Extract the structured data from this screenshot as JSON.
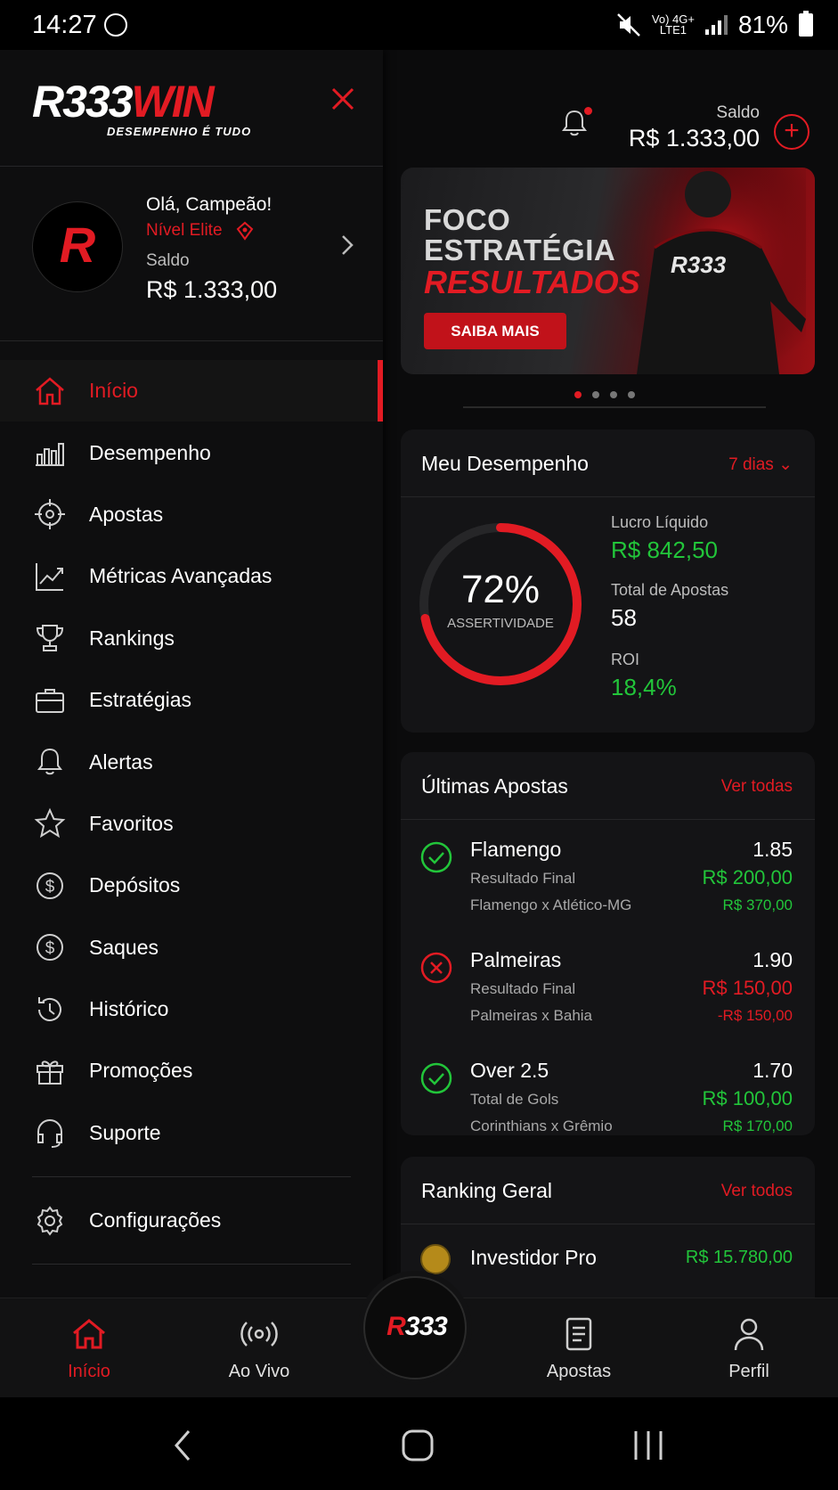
{
  "status_bar": {
    "time": "14:27",
    "network_top": "Vo) 4G+",
    "network_bottom": "LTE1",
    "battery": "81%"
  },
  "header": {
    "saldo_label": "Saldo",
    "saldo_value": "R$ 1.333,00",
    "add_icon": "plus-circle-icon",
    "bell_icon": "bell-icon"
  },
  "banner": {
    "line1": "FOCO",
    "line2": "ESTRATÉGIA",
    "line3": "RESULTADOS",
    "cta": "SAIBA MAIS",
    "jersey_text": "R333",
    "dots_count": 4,
    "active_dot": 0
  },
  "performance": {
    "title": "Meu Desempenho",
    "period": "7 dias",
    "percent_text": "72%",
    "percent": 72,
    "percent_label": "ASSERTIVIDADE",
    "stats": [
      {
        "label": "Lucro Líquido",
        "value": "R$ 842,50",
        "color": "#22c53a"
      },
      {
        "label": "Total de Apostas",
        "value": "58",
        "color": "#ffffff"
      },
      {
        "label": "ROI",
        "value": "18,4%",
        "color": "#22c53a"
      }
    ]
  },
  "bets": {
    "title": "Últimas Apostas",
    "link": "Ver todas",
    "items": [
      {
        "name": "Flamengo",
        "market": "Resultado Final",
        "match": "Flamengo x Atlético-MG",
        "odd": "1.85",
        "stake": "R$ 200,00",
        "ret": "R$ 370,00",
        "status": "won"
      },
      {
        "name": "Palmeiras",
        "market": "Resultado Final",
        "match": "Palmeiras x Bahia",
        "odd": "1.90",
        "stake": "R$ 150,00",
        "ret": "-R$ 150,00",
        "status": "lost"
      },
      {
        "name": "Over 2.5",
        "market": "Total de Gols",
        "match": "Corinthians x Grêmio",
        "odd": "1.70",
        "stake": "R$ 100,00",
        "ret": "R$ 170,00",
        "status": "won"
      }
    ]
  },
  "ranking": {
    "title": "Ranking Geral",
    "link": "Ver todos",
    "first_name": "Investidor Pro",
    "first_value": "R$ 15.780,00"
  },
  "drawer": {
    "logo_white": "R333",
    "logo_red": "WIN",
    "tagline": "DESEMPENHO É TUDO",
    "greeting": "Olá, Campeão!",
    "level": "Nível Elite",
    "saldo_label": "Saldo",
    "saldo_value": "R$ 1.333,00",
    "avatar_letter": "R",
    "menu": [
      {
        "label": "Início",
        "icon": "home-icon",
        "active": true
      },
      {
        "label": "Desempenho",
        "icon": "bar-chart-icon"
      },
      {
        "label": "Apostas",
        "icon": "target-icon"
      },
      {
        "label": "Métricas Avançadas",
        "icon": "line-chart-icon"
      },
      {
        "label": "Rankings",
        "icon": "trophy-icon"
      },
      {
        "label": "Estratégias",
        "icon": "briefcase-icon"
      },
      {
        "label": "Alertas",
        "icon": "bell-icon"
      },
      {
        "label": "Favoritos",
        "icon": "star-icon"
      },
      {
        "label": "Depósitos",
        "icon": "dollar-circle-icon"
      },
      {
        "label": "Saques",
        "icon": "dollar-circle-icon"
      },
      {
        "label": "Histórico",
        "icon": "history-icon"
      },
      {
        "label": "Promoções",
        "icon": "gift-icon"
      },
      {
        "label": "Suporte",
        "icon": "headset-icon"
      }
    ],
    "settings_label": "Configurações"
  },
  "bottom_nav": {
    "items": [
      {
        "label": "Início",
        "icon": "home-icon",
        "active": true
      },
      {
        "label": "Ao Vivo",
        "icon": "live-icon"
      },
      {
        "label": "Apostas",
        "icon": "ticket-icon"
      },
      {
        "label": "Perfil",
        "icon": "user-icon"
      }
    ],
    "fab_white": "333",
    "fab_red": "R"
  },
  "colors": {
    "accent": "#e21b23",
    "positive": "#22c53a",
    "background": "#0b0b0c"
  }
}
